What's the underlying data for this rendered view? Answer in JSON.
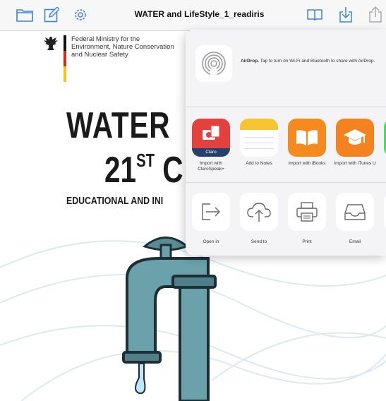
{
  "toolbar": {
    "title": "WATER and LifeStyle_1_readiris",
    "icons": [
      "folder-icon",
      "edit-icon",
      "settings-icon",
      "book-icon",
      "download-icon",
      "share-icon"
    ],
    "accent_color": "#3a86e0"
  },
  "document": {
    "ministry": {
      "line1": "Federal Ministry for the",
      "line2": "Environment, Nature Conservation",
      "line3": "and Nuclear Safety"
    },
    "title_line1": "WATER",
    "title_line2_prefix": "21",
    "title_line2_sup": "ST",
    "title_line2_rest": " C",
    "subheading": "EDUCATIONAL AND INI"
  },
  "share_sheet": {
    "airdrop": {
      "title": "AirDrop.",
      "description": " Tap to turn on Wi-Fi and Bluetooth to share with AirDrop."
    },
    "apps": [
      {
        "label": "Import with ClaroSpeak+",
        "badge": "Claro",
        "color": "#e2413d"
      },
      {
        "label": "Add to Notes",
        "color": "#f7c531"
      },
      {
        "label": "Import with iBooks",
        "color": "#f58a1f"
      },
      {
        "label": "Import with iTunes U",
        "color": "#f4821e"
      },
      {
        "label": "",
        "color": "#4cd964"
      }
    ],
    "actions": [
      {
        "label": "Open in",
        "icon": "open-in-icon"
      },
      {
        "label": "Send to",
        "icon": "upload-cloud-icon"
      },
      {
        "label": "Print",
        "icon": "printer-icon"
      },
      {
        "label": "Email",
        "icon": "inbox-icon"
      }
    ]
  }
}
